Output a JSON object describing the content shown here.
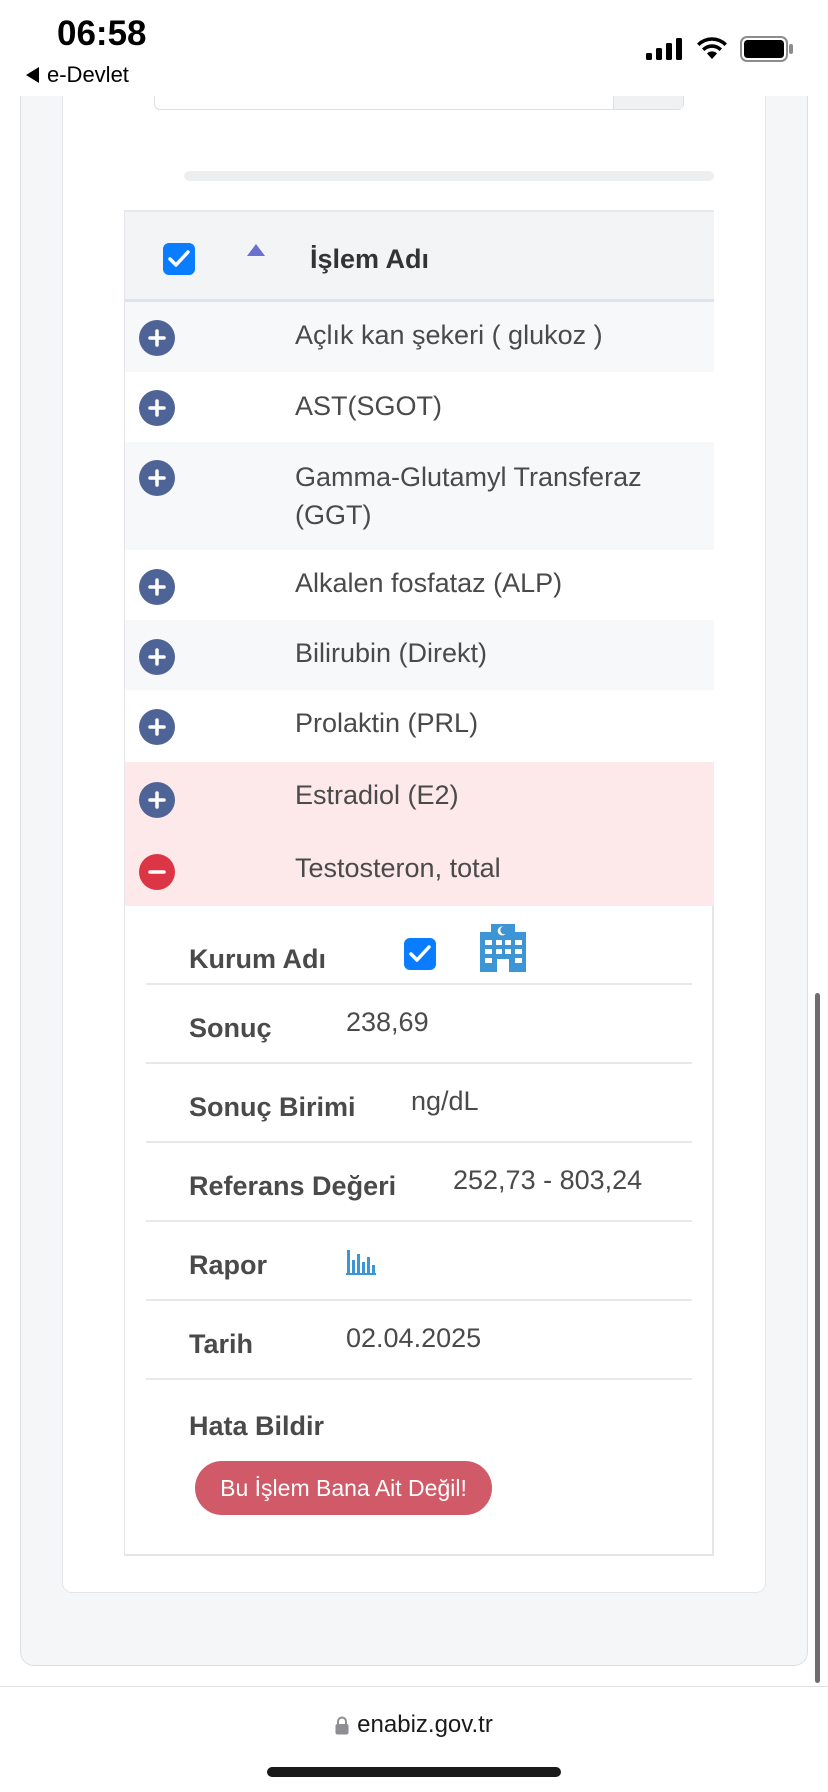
{
  "status_bar": {
    "time": "06:58",
    "back_label": "e-Devlet"
  },
  "table": {
    "header_label": "İşlem Adı",
    "rows": [
      {
        "label": "Açlık kan şekeri ( glukoz )"
      },
      {
        "label": "AST(SGOT)"
      },
      {
        "label": "Gamma-Glutamyl Transferaz (GGT)"
      },
      {
        "label": "Alkalen fosfataz (ALP)"
      },
      {
        "label": "Bilirubin (Direkt)"
      },
      {
        "label": "Prolaktin (PRL)"
      },
      {
        "label": "Estradiol (E2)"
      },
      {
        "label": "Testosteron, total"
      }
    ]
  },
  "detail": {
    "kurum_label": "Kurum Adı",
    "sonuc_label": "Sonuç",
    "sonuc_value": "238,69",
    "birim_label": "Sonuç Birimi",
    "birim_value": "ng/dL",
    "referans_label": "Referans Değeri",
    "referans_value": "252,73 - 803,24",
    "rapor_label": "Rapor",
    "tarih_label": "Tarih",
    "tarih_value": "02.04.2025",
    "hata_label": "Hata Bildir",
    "report_button": "Bu İşlem Bana Ait Değil!"
  },
  "address_bar": {
    "url": "enabiz.gov.tr"
  },
  "colors": {
    "toggle_plus": "#4f6496",
    "toggle_minus": "#dc3545",
    "danger_row": "#fde8ea",
    "checkbox": "#0a7cff",
    "report_button": "#d05a67",
    "icon_blue": "#3d95d6"
  }
}
